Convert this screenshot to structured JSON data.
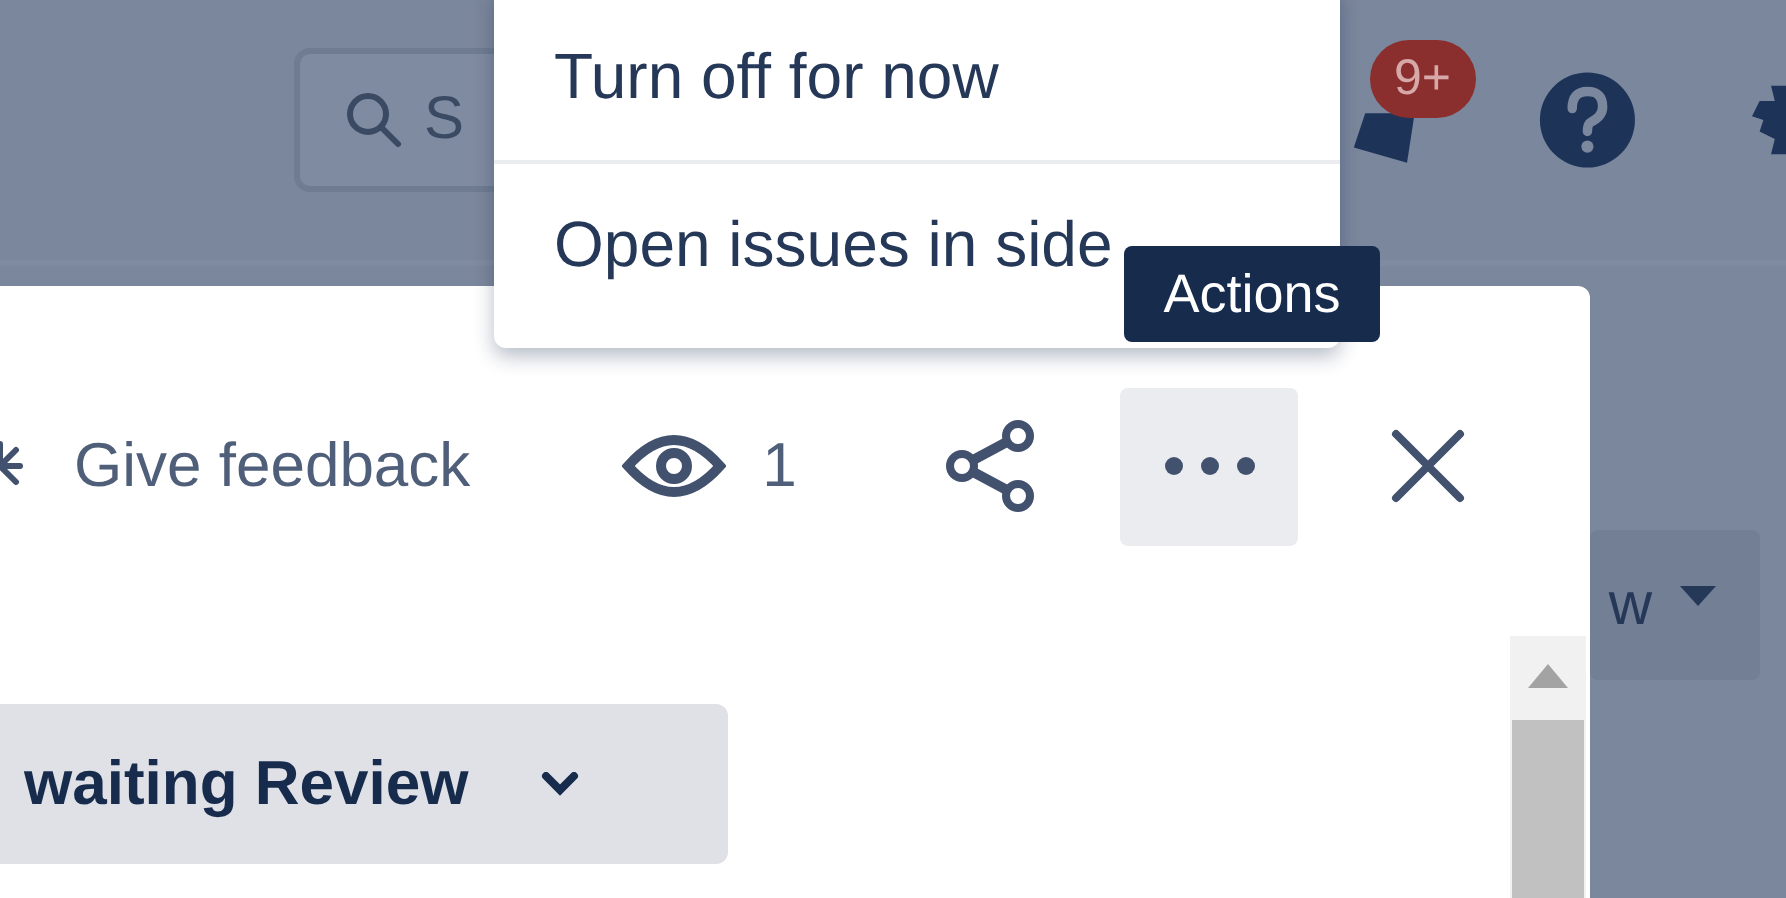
{
  "header": {
    "search": {
      "placeholder": "S"
    },
    "notifications": {
      "badge": "9+"
    }
  },
  "background_button": {
    "label": "w"
  },
  "panel": {
    "feedback": "Give feedback",
    "watchers": "1",
    "actions_button": {
      "selected": true
    },
    "status": {
      "label": "waiting Review"
    }
  },
  "menu": {
    "items": [
      {
        "label": "Turn off for now"
      },
      {
        "label": "Open issues in side"
      }
    ]
  },
  "tooltip": "Actions"
}
